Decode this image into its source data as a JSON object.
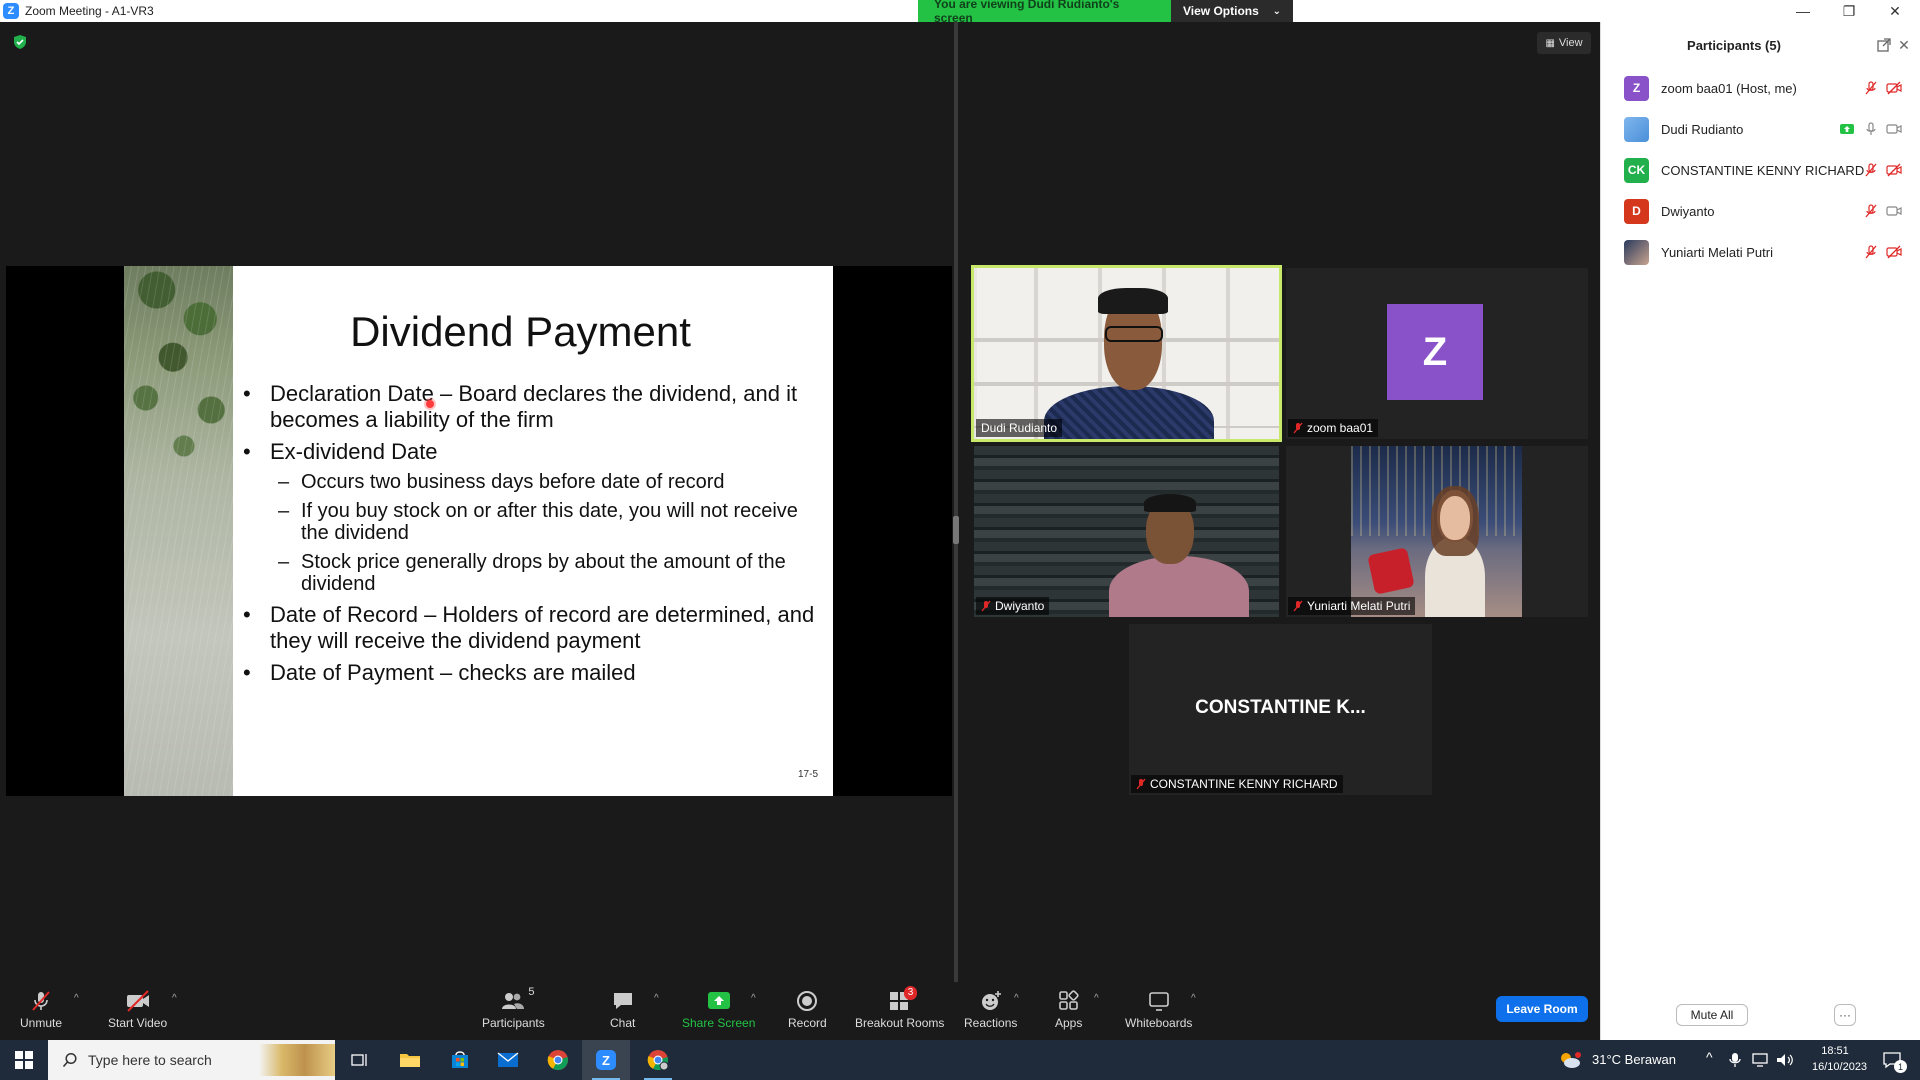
{
  "window": {
    "title": "Zoom Meeting - A1-VR3",
    "controls": [
      "minimize",
      "restore",
      "close"
    ]
  },
  "banner": {
    "message": "You are viewing Dudi Rudianto's screen",
    "view_options": "View Options"
  },
  "view_button": "View",
  "slide": {
    "title": "Dividend Payment",
    "bullets": [
      {
        "level": 1,
        "text": "Declaration Date – Board declares the dividend, and it becomes a liability of the firm"
      },
      {
        "level": 1,
        "text": "Ex-dividend Date"
      },
      {
        "level": 2,
        "text": "Occurs two business days before date of record"
      },
      {
        "level": 2,
        "text": "If you buy stock on or after this date, you will not receive the dividend"
      },
      {
        "level": 2,
        "text": "Stock price generally drops by about the amount of the dividend"
      },
      {
        "level": 1,
        "text": "Date of Record – Holders of record are determined, and they will receive the dividend payment"
      },
      {
        "level": 1,
        "text": "Date of Payment – checks are mailed"
      }
    ],
    "page_number": "17-5"
  },
  "tiles": {
    "dudi": {
      "name": "Dudi Rudianto"
    },
    "zoom": {
      "name": "zoom baa01",
      "avatar": "Z"
    },
    "dwiyanto": {
      "name": "Dwiyanto"
    },
    "yuniarti": {
      "name": "Yuniarti Melati Putri"
    },
    "constantine": {
      "name": "CONSTANTINE KENNY RICHARD",
      "display": "CONSTANTINE  K..."
    }
  },
  "toolbar": {
    "unmute": "Unmute",
    "start_video": "Start Video",
    "participants": "Participants",
    "participants_count": "5",
    "chat": "Chat",
    "share_screen": "Share Screen",
    "record": "Record",
    "breakout_rooms": "Breakout Rooms",
    "breakout_badge": "3",
    "reactions": "Reactions",
    "apps": "Apps",
    "whiteboards": "Whiteboards",
    "leave": "Leave Room"
  },
  "participants_panel": {
    "title": "Participants (5)",
    "items": [
      {
        "initials": "Z",
        "name": "zoom baa01 (Host, me)",
        "color": "#8a52c9",
        "mic": "muted",
        "video": "off"
      },
      {
        "initials": "",
        "name": "Dudi Rudianto",
        "color": "#5aa0e8",
        "mic": "on",
        "video": "on",
        "sharing": true
      },
      {
        "initials": "CK",
        "name": "CONSTANTINE KENNY RICHARD",
        "color": "#21b04b",
        "mic": "muted",
        "video": "off"
      },
      {
        "initials": "D",
        "name": "Dwiyanto",
        "color": "#d4371c",
        "mic": "muted",
        "video": "on"
      },
      {
        "initials": "",
        "name": "Yuniarti Melati Putri",
        "color": "#3a4a6a",
        "mic": "muted",
        "video": "off"
      }
    ],
    "mute_all": "Mute All",
    "more": "···"
  },
  "taskbar": {
    "search_placeholder": "Type here to search",
    "weather": "31°C  Berawan",
    "time": "18:51",
    "date": "16/10/2023",
    "notification_count": "1"
  },
  "colors": {
    "meeting_bg": "#1a1a1a",
    "banner_green": "#23c245",
    "leave_blue": "#0e71eb",
    "mute_red": "#e02828",
    "active_speaker": "#c8e86a"
  }
}
